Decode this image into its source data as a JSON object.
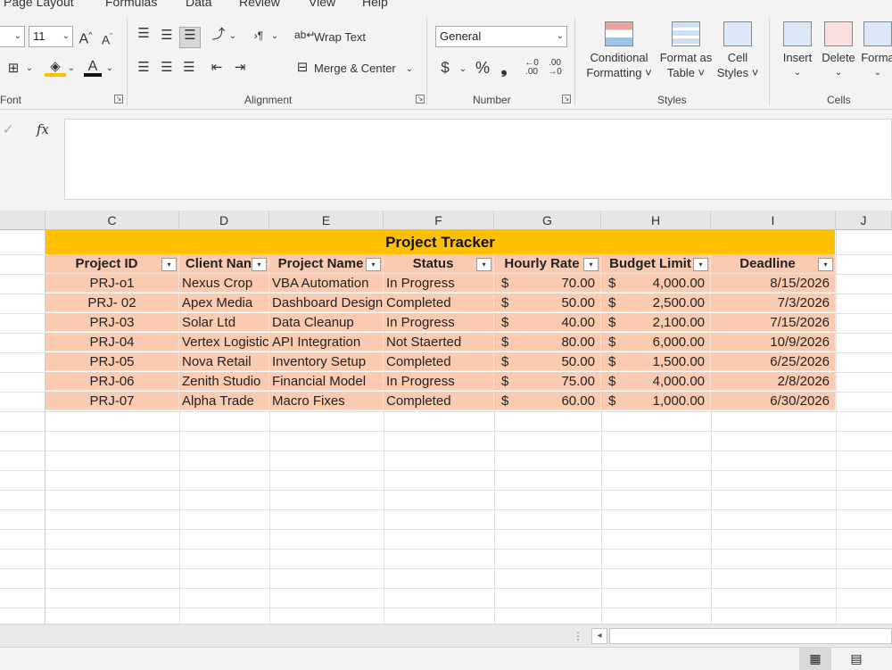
{
  "ribbon": {
    "tabs": [
      "Page Layout",
      "Formulas",
      "Data",
      "Review",
      "View",
      "Help"
    ],
    "font_size": "11",
    "grow_font": "A^",
    "shrink_font": "A˅",
    "font_group_label": "Font",
    "alignment_group_label": "Alignment",
    "wrap_text": "Wrap Text",
    "merge_center": "Merge & Center",
    "number_format": "General",
    "number_group_label": "Number",
    "currency": "$",
    "percent": "%",
    "comma": "❟",
    "conditional_formatting": [
      "Conditional",
      "Formatting ˅"
    ],
    "format_as_table": [
      "Format as",
      "Table ˅"
    ],
    "cell_styles": [
      "Cell",
      "Styles ˅"
    ],
    "styles_group_label": "Styles",
    "insert": "Insert",
    "delete": "Delete",
    "format": "Forma",
    "cells_group_label": "Cells"
  },
  "formula_bar": {
    "fx": "fx",
    "content": ""
  },
  "columns": [
    "C",
    "D",
    "E",
    "F",
    "G",
    "H",
    "I",
    "J"
  ],
  "sheet": {
    "title": "Project Tracker",
    "headers": [
      "Project ID",
      "Client Nan",
      "Project Name",
      "Status",
      "Hourly Rate",
      "Budget Limit",
      "Deadline"
    ],
    "rows": [
      [
        "PRJ-o1",
        "Nexus Crop",
        "VBA Automation",
        "In Progress",
        "$",
        "70.00",
        "$",
        "4,000.00",
        "8/15/2026"
      ],
      [
        "PRJ- 02",
        "Apex Media",
        "Dashboard Design",
        "Completed",
        "$",
        "50.00",
        "$",
        "2,500.00",
        "7/3/2026"
      ],
      [
        "PRJ-03",
        "Solar Ltd",
        "Data Cleanup",
        "In Progress",
        "$",
        "40.00",
        "$",
        "2,100.00",
        "7/15/2026"
      ],
      [
        "PRJ-04",
        "Vertex Logistic",
        "API Integration",
        "Not Staerted",
        "$",
        "80.00",
        "$",
        "6,000.00",
        "10/9/2026"
      ],
      [
        "PRJ-05",
        "Nova Retail",
        "Inventory Setup",
        "Completed",
        "$",
        "50.00",
        "$",
        "1,500.00",
        "6/25/2026"
      ],
      [
        "PRJ-06",
        "Zenith Studio",
        "Financial Model",
        "In Progress",
        "$",
        "75.00",
        "$",
        "4,000.00",
        "2/8/2026"
      ],
      [
        "PRJ-07",
        "Alpha Trade",
        "Macro Fixes",
        "Completed",
        "$",
        "60.00",
        "$",
        "1,000.00",
        "6/30/2026"
      ]
    ]
  },
  "colors": {
    "title_fill": "#ffc000",
    "table_fill": "#fbcbb1"
  }
}
